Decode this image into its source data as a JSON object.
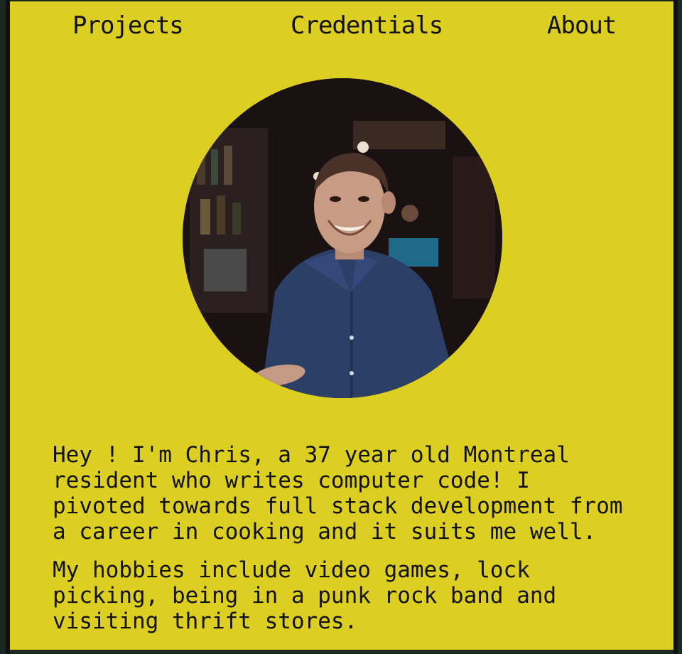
{
  "nav": {
    "items": [
      {
        "label": "Projects"
      },
      {
        "label": "Credentials"
      },
      {
        "label": "About"
      }
    ]
  },
  "bio": {
    "paragraph_1": "Hey ! I'm Chris, a 37 year old Montreal resident who writes computer code! I pivoted towards full stack development from a career in cooking and it suits me well.",
    "paragraph_2": "My hobbies include video games, lock picking, being in a punk rock band and visiting thrift stores."
  },
  "colors": {
    "background": "#ddcf22",
    "text": "#111111",
    "frame": "#111111"
  }
}
